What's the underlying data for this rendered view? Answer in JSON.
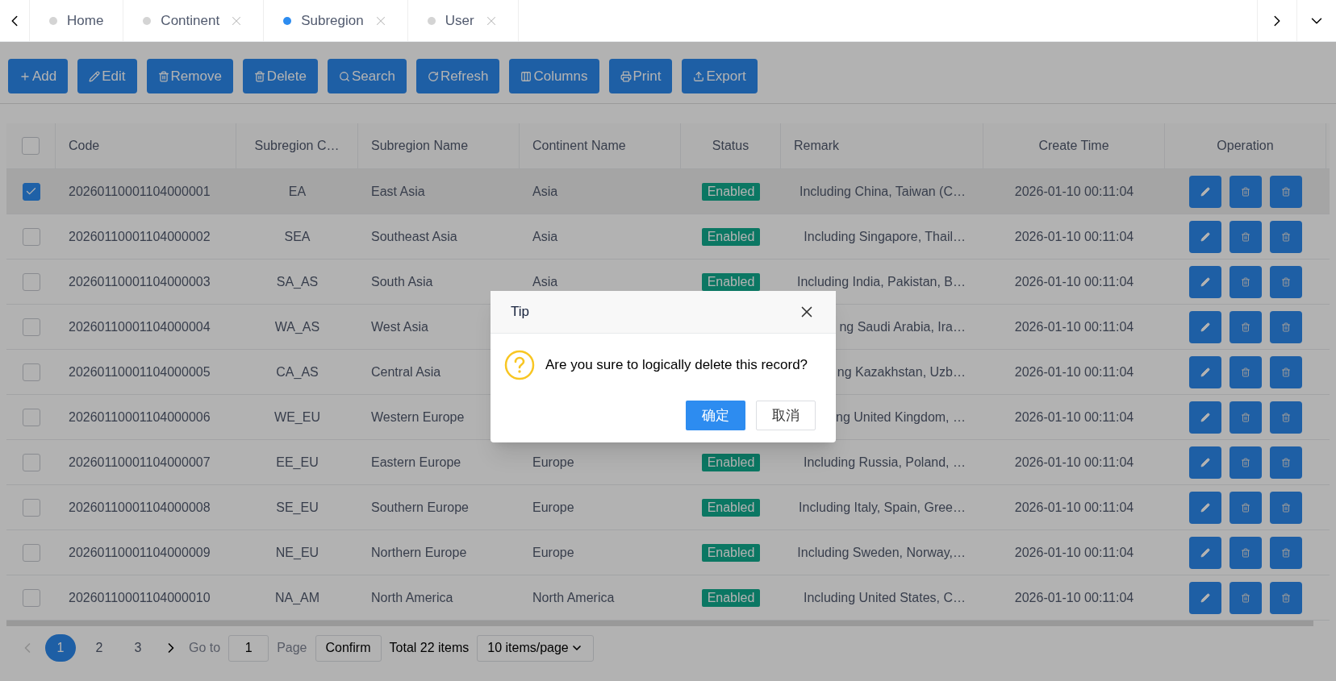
{
  "tabs": [
    {
      "label": "Home",
      "selected": false,
      "closable": false
    },
    {
      "label": "Continent",
      "selected": false,
      "closable": true
    },
    {
      "label": "Subregion",
      "selected": true,
      "closable": true
    },
    {
      "label": "User",
      "selected": false,
      "closable": true
    }
  ],
  "toolbar": [
    "Add",
    "Edit",
    "Remove",
    "Delete",
    "Search",
    "Refresh",
    "Columns",
    "Print",
    "Export"
  ],
  "table": {
    "columns": [
      "Code",
      "Subregion C…",
      "Subregion Name",
      "Continent Name",
      "Status",
      "Remark",
      "Create Time",
      "Operation"
    ],
    "header_checkbox": {
      "checked": false
    },
    "rows": [
      {
        "checked": true,
        "code": "20260110001104000001",
        "subregion_code": "EA",
        "subregion_name": "East Asia",
        "continent_name": "Asia",
        "status": "Enabled",
        "remark": "Including China, Taiwan (C…",
        "create_time": "2026-01-10 00:11:04"
      },
      {
        "checked": false,
        "code": "20260110001104000002",
        "subregion_code": "SEA",
        "subregion_name": "Southeast Asia",
        "continent_name": "Asia",
        "status": "Enabled",
        "remark": "Including Singapore, Thail…",
        "create_time": "2026-01-10 00:11:04"
      },
      {
        "checked": false,
        "code": "20260110001104000003",
        "subregion_code": "SA_AS",
        "subregion_name": "South Asia",
        "continent_name": "Asia",
        "status": "Enabled",
        "remark": "Including India, Pakistan, B…",
        "create_time": "2026-01-10 00:11:04"
      },
      {
        "checked": false,
        "code": "20260110001104000004",
        "subregion_code": "WA_AS",
        "subregion_name": "West Asia",
        "remark": "ng Saudi Arabia, Ira…",
        "create_time": "2026-01-10 00:11:04"
      },
      {
        "checked": false,
        "code": "20260110001104000005",
        "subregion_code": "CA_AS",
        "subregion_name": "Central Asia",
        "remark": "ng Kazakhstan, Uzb…",
        "create_time": "2026-01-10 00:11:04"
      },
      {
        "checked": false,
        "code": "20260110001104000006",
        "subregion_code": "WE_EU",
        "subregion_name": "Western Europe",
        "remark": "ng United Kingdom, …",
        "create_time": "2026-01-10 00:11:04"
      },
      {
        "checked": false,
        "code": "20260110001104000007",
        "subregion_code": "EE_EU",
        "subregion_name": "Eastern Europe",
        "continent_name": "Europe",
        "status": "Enabled",
        "remark": "Including Russia, Poland, …",
        "create_time": "2026-01-10 00:11:04"
      },
      {
        "checked": false,
        "code": "20260110001104000008",
        "subregion_code": "SE_EU",
        "subregion_name": "Southern Europe",
        "continent_name": "Europe",
        "status": "Enabled",
        "remark": "Including Italy, Spain, Gree…",
        "create_time": "2026-01-10 00:11:04"
      },
      {
        "checked": false,
        "code": "20260110001104000009",
        "subregion_code": "NE_EU",
        "subregion_name": "Northern Europe",
        "continent_name": "Europe",
        "status": "Enabled",
        "remark": "Including Sweden, Norway,…",
        "create_time": "2026-01-10 00:11:04"
      },
      {
        "checked": false,
        "code": "20260110001104000010",
        "subregion_code": "NA_AM",
        "subregion_name": "North America",
        "continent_name": "North America",
        "status": "Enabled",
        "remark": "Including United States, C…",
        "create_time": "2026-01-10 00:11:04"
      }
    ]
  },
  "pagination": {
    "prev_disabled": true,
    "pages": [
      {
        "label": "1",
        "selected": true
      },
      {
        "label": "2",
        "selected": false
      },
      {
        "label": "3",
        "selected": false
      }
    ],
    "goto_label": "Go to",
    "goto_value": "1",
    "page_label": "Page",
    "confirm": "Confirm",
    "total": "Total 22 items",
    "page_size": "10 items/page"
  },
  "dialog": {
    "title": "Tip",
    "message": "Are you sure to logically delete this record?",
    "ok": "确定",
    "cancel": "取消"
  }
}
